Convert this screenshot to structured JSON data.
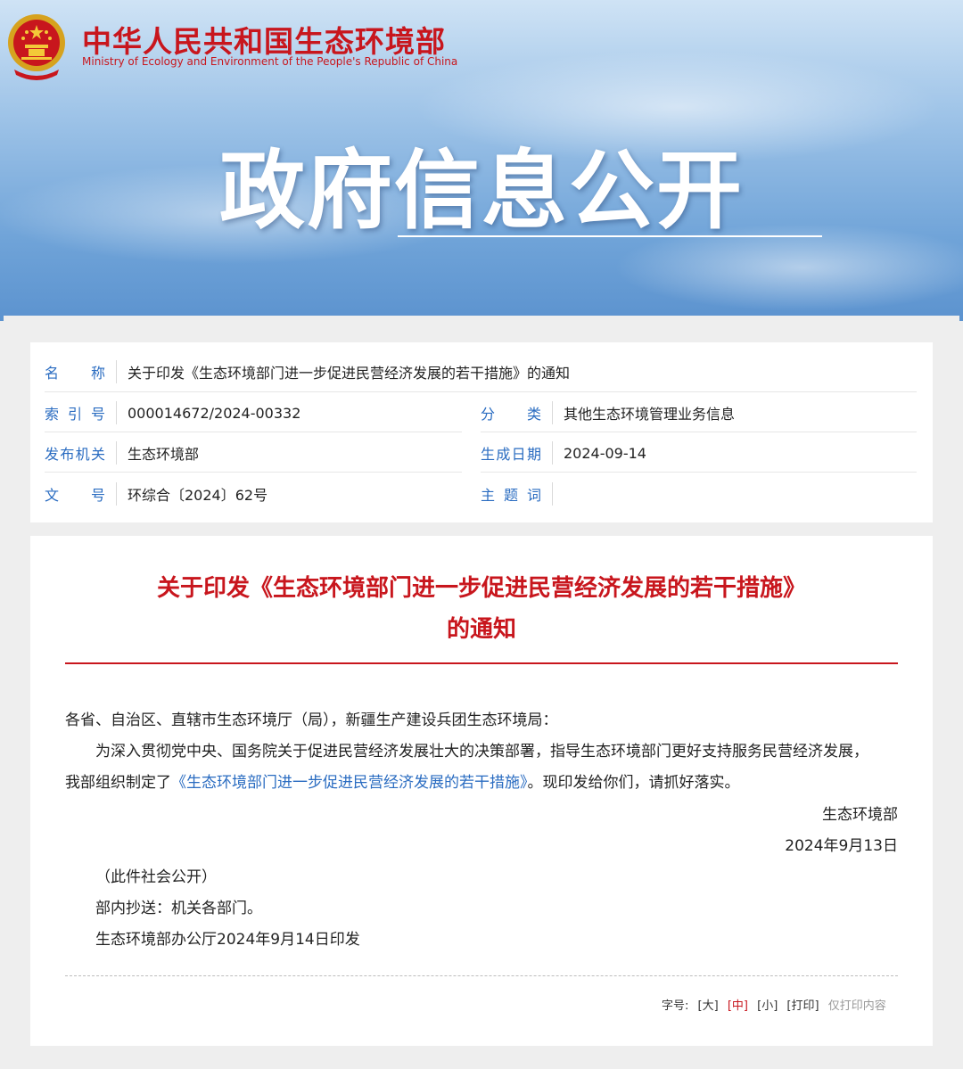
{
  "header": {
    "ministry_cn": "中华人民共和国生态环境部",
    "ministry_en": "Ministry of Ecology and Environment of the People's Republic of China",
    "banner_title": "政府信息公开",
    "emblem_icon": "national-emblem-icon"
  },
  "meta": {
    "name_label": "名称",
    "name_value": "关于印发《生态环境部门进一步促进民营经济发展的若干措施》的通知",
    "index_label": "索引号",
    "index_value": "000014672/2024-00332",
    "category_label": "分类",
    "category_value": "其他生态环境管理业务信息",
    "issuer_label": "发布机关",
    "issuer_value": "生态环境部",
    "date_label": "生成日期",
    "date_value": "2024-09-14",
    "docno_label": "文号",
    "docno_value": "环综合〔2024〕62号",
    "keywords_label": "主题词",
    "keywords_value": ""
  },
  "document": {
    "title_line1": "关于印发《生态环境部门进一步促进民营经济发展的若干措施》",
    "title_line2": "的通知",
    "salutation": "各省、自治区、直辖市生态环境厅（局），新疆生产建设兵团生态环境局：",
    "para1_line1": "为深入贯彻党中央、国务院关于促进民营经济发展壮大的决策部署，指导生态环境部门更好支持服务民营经济发展，",
    "para1_line2_pre": "我部组织制定了",
    "para1_link": "《生态环境部门进一步促进民营经济发展的若干措施》",
    "para1_line2_post": "。现印发给你们，请抓好落实。",
    "signature": "生态环境部",
    "sign_date": "2024年9月13日",
    "public_note": "（此件社会公开）",
    "cc": "部内抄送：机关各部门。",
    "printed": "生态环境部办公厅2024年9月14日印发"
  },
  "tools": {
    "font_label": "字号:",
    "large": "[大]",
    "medium": "[中]",
    "small": "[小]",
    "print": "[打印]",
    "print_content": "仅打印内容"
  },
  "colors": {
    "brand_red": "#c8161d",
    "link_blue": "#2a6cc1"
  }
}
